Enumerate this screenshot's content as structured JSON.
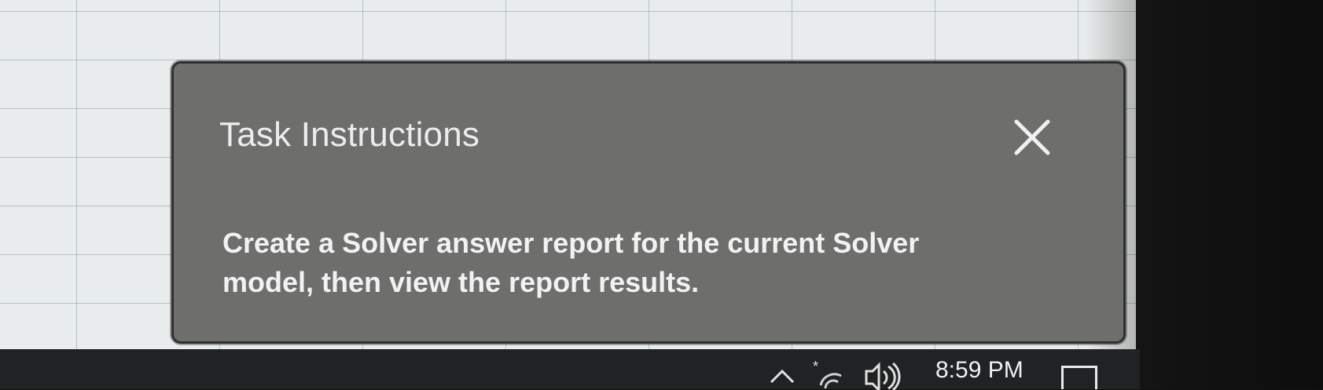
{
  "dialog": {
    "title": "Task Instructions",
    "body": "Create a Solver answer report for the current Solver model, then view the report results.",
    "close_icon": "close-icon"
  },
  "taskbar": {
    "clock": "8:59 PM",
    "icons": [
      "chevron-up-icon",
      "network-icon",
      "volume-icon",
      "notification-icon"
    ]
  },
  "colors": {
    "dialog_bg": "#6e6f6d",
    "dialog_text": "#f2f2f2",
    "taskbar_bg": "#202224",
    "sheet_bg": "#e9ecec"
  }
}
